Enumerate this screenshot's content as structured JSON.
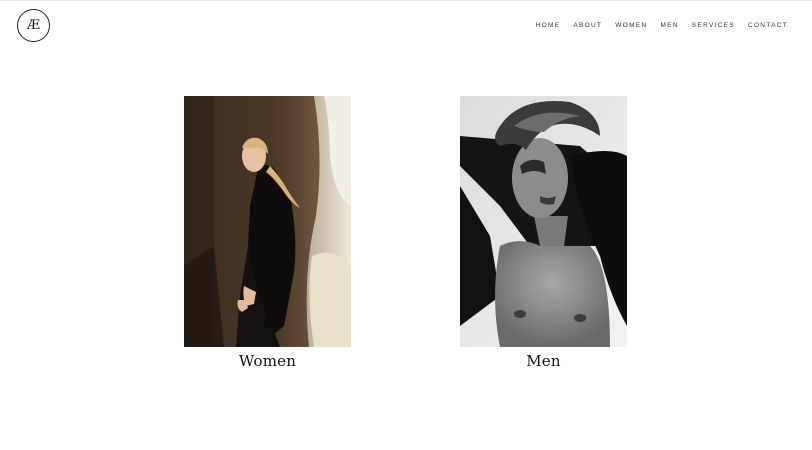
{
  "logo": {
    "text": "Æ"
  },
  "nav": {
    "items": [
      {
        "label": "HOME"
      },
      {
        "label": "ABOUT"
      },
      {
        "label": "WOMEN"
      },
      {
        "label": "MEN"
      },
      {
        "label": "SERVICES"
      },
      {
        "label": "CONTACT"
      }
    ]
  },
  "gallery": {
    "tiles": [
      {
        "caption": "Women",
        "image": "woman-in-black-outfit-photo"
      },
      {
        "caption": "Men",
        "image": "shirtless-man-bw-photo"
      }
    ]
  },
  "colors": {
    "background": "#ffffff",
    "text": "#111111",
    "nav_text": "#333333"
  }
}
